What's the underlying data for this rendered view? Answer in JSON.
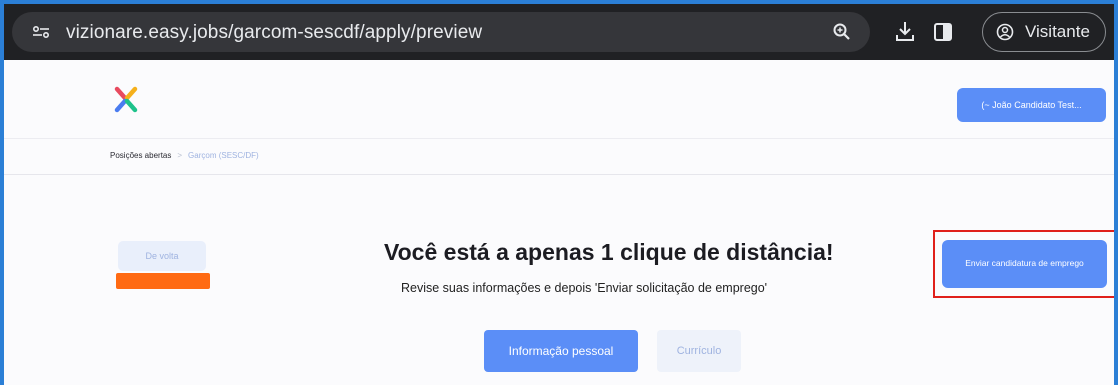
{
  "browser": {
    "url": "vizionare.easy.jobs/garcom-sescdf/apply/preview",
    "profile_label": "Visitante"
  },
  "header": {
    "user_button_label": "(~ João Candidato Test..."
  },
  "breadcrumb": {
    "root": "Posições abertas",
    "separator": ">",
    "current": "Garçom (SESC/DF)"
  },
  "main": {
    "back_button_label": "De volta",
    "headline": "Você está a apenas 1 clique de distância!",
    "subline": "Revise suas informações e depois 'Enviar solicitação de emprego'",
    "apply_button_label": "Enviar candidatura de emprego",
    "tabs": [
      {
        "label": "Informação pessoal",
        "active": true
      },
      {
        "label": "Currículo",
        "active": false
      }
    ]
  },
  "colors": {
    "accent": "#5b8ef7",
    "highlight": "#e0201b",
    "redaction": "#ff6a13"
  },
  "icons": [
    "site-info-icon",
    "zoom-icon",
    "download-icon",
    "side-panel-icon",
    "profile-icon",
    "logo-icon"
  ]
}
